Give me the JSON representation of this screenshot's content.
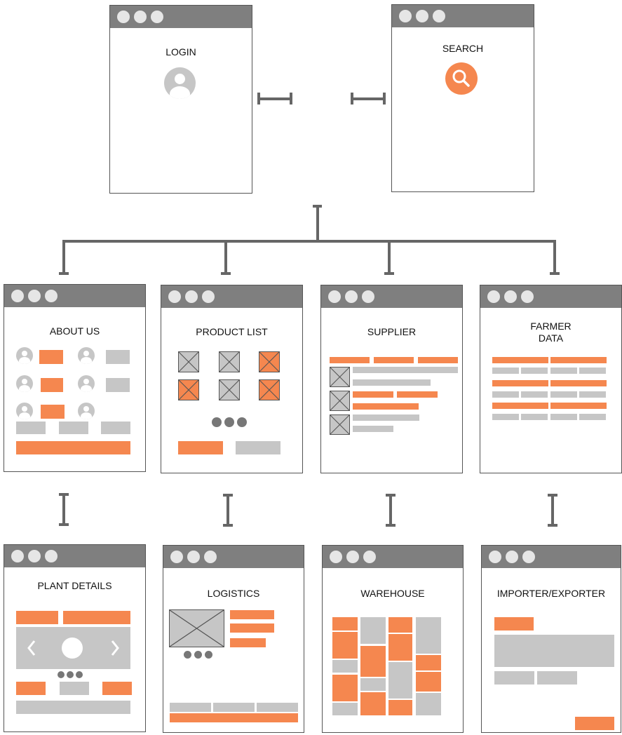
{
  "screens": {
    "login": {
      "title": "LOGIN",
      "icon": "user-avatar-icon"
    },
    "search": {
      "title": "SEARCH",
      "icon": "search-icon"
    },
    "about_us": {
      "title": "ABOUT US"
    },
    "product_list": {
      "title": "PRODUCT LIST"
    },
    "supplier": {
      "title": "SUPPLIER"
    },
    "farmer_data": {
      "title": "FARMER\nDATA"
    },
    "plant_details": {
      "title": "PLANT DETAILS"
    },
    "logistics": {
      "title": "LOGISTICS"
    },
    "warehouse": {
      "title": "WAREHOUSE"
    },
    "importer_exporter": {
      "title": "IMPORTER/EXPORTER"
    }
  },
  "colors": {
    "accent": "#f5874f",
    "placeholder": "#c6c6c6",
    "titlebar": "#7f7f7f",
    "connector": "#666666",
    "dot": "#e6e6e6"
  }
}
